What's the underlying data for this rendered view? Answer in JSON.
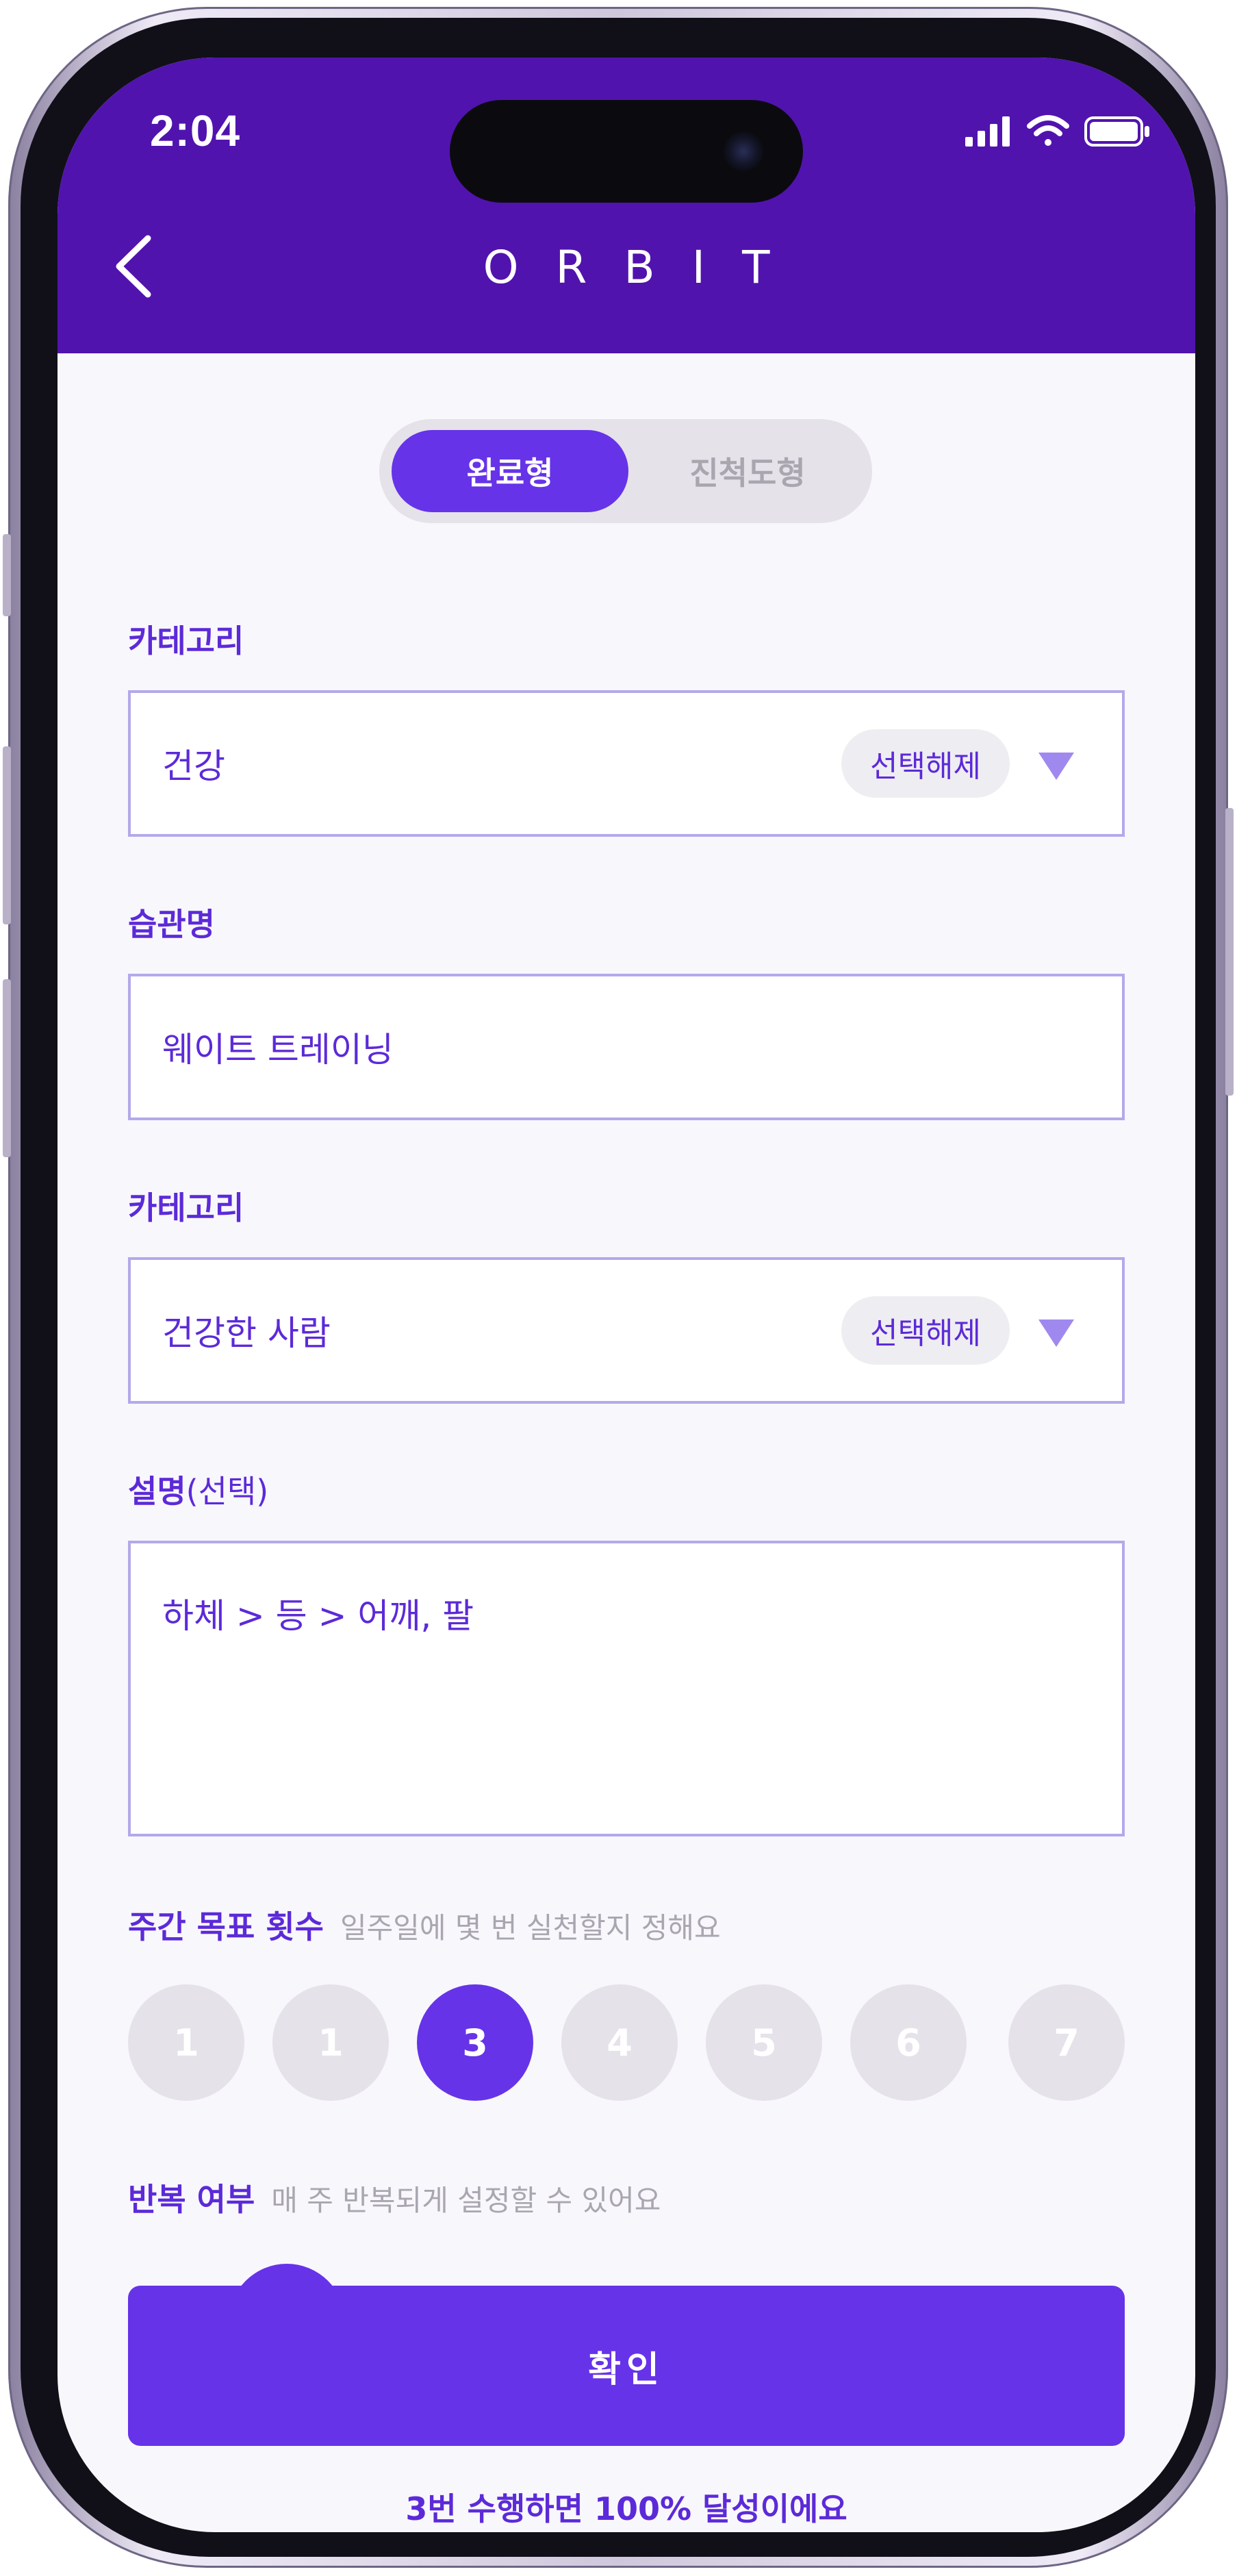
{
  "status_bar": {
    "time": "2:04"
  },
  "header": {
    "title": "ORBIT",
    "back_icon": "chevron-left-icon"
  },
  "type_toggle": {
    "options": [
      {
        "label": "완료형",
        "selected": true
      },
      {
        "label": "진척도형",
        "selected": false
      }
    ]
  },
  "fields": {
    "category_1": {
      "label": "카테고리",
      "value": "건강",
      "chip": "선택해제"
    },
    "habit_name": {
      "label": "습관명",
      "value": "웨이트 트레이닝"
    },
    "category_2": {
      "label": "카테고리",
      "value": "건강한 사람",
      "chip": "선택해제"
    },
    "description": {
      "label": "설명",
      "label_suffix": "(선택)",
      "value": "하체 > 등 > 어깨, 팔"
    }
  },
  "weekly_goal": {
    "label": "주간 목표 횟수",
    "hint": "일주일에 몇 번 실천할지 정해요",
    "days": [
      "1",
      "1",
      "3",
      "4",
      "5",
      "6",
      "7"
    ],
    "selected_index": 2
  },
  "repeat": {
    "label": "반복 여부",
    "hint": "매 주 반복되게 설정할 수 있어요"
  },
  "confirm_button": {
    "label": "확인"
  },
  "footer_note": "3번 수행하면 100% 달성이에요",
  "colors": {
    "header": "#5113ae",
    "accent": "#6633e8",
    "text_accent": "#5c2ad8",
    "muted": "#a9a6b0",
    "chip_bg": "#eeedf1",
    "border": "#b3a9ea"
  }
}
